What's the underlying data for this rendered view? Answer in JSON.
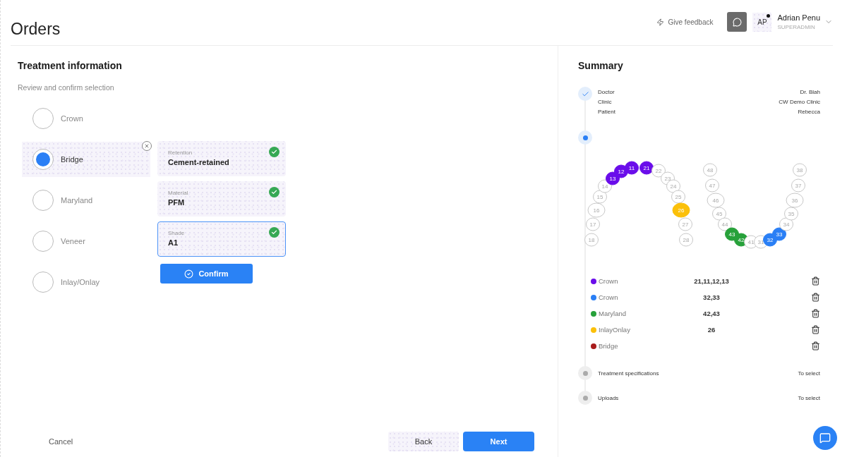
{
  "header": {
    "title": "Orders",
    "feedback": "Give feedback",
    "user": {
      "initials": "AP",
      "name": "Adrian Penu",
      "role": "SUPERADMIN",
      "online": true
    }
  },
  "treatment": {
    "title": "Treatment information",
    "subtitle": "Review and confirm selection",
    "options": [
      {
        "label": "Crown",
        "selected": false
      },
      {
        "label": "Bridge",
        "selected": true
      },
      {
        "label": "Maryland",
        "selected": false
      },
      {
        "label": "Veneer",
        "selected": false
      },
      {
        "label": "Inlay/Onlay",
        "selected": false
      }
    ],
    "fields": [
      {
        "label": "Retention",
        "value": "Cement-retained",
        "checked": true,
        "focused": false
      },
      {
        "label": "Material",
        "value": "PFM",
        "checked": true,
        "focused": false
      },
      {
        "label": "Shade",
        "value": "A1",
        "checked": true,
        "focused": true
      }
    ],
    "confirm": "Confirm"
  },
  "footer": {
    "cancel": "Cancel",
    "back": "Back",
    "next": "Next"
  },
  "summary": {
    "title": "Summary",
    "steps": [
      {
        "kind": "done",
        "details": [
          {
            "label": "Doctor",
            "value": "Dr. Blah"
          },
          {
            "label": "Clinic",
            "value": "CW Demo Clinic"
          },
          {
            "label": "Patient",
            "value": "Rebecca"
          }
        ]
      },
      {
        "kind": "current",
        "teeth": [
          {
            "number": "18"
          },
          {
            "number": "17"
          },
          {
            "number": "16"
          },
          {
            "number": "15"
          },
          {
            "number": "14"
          },
          {
            "number": "13",
            "color": "#6a0dea"
          },
          {
            "number": "12",
            "color": "#6a0dea"
          },
          {
            "number": "11",
            "color": "#6a0dea"
          },
          {
            "number": "21",
            "color": "#6a0dea"
          },
          {
            "number": "22"
          },
          {
            "number": "23"
          },
          {
            "number": "24"
          },
          {
            "number": "25"
          },
          {
            "number": "26",
            "color": "#fbc00a"
          },
          {
            "number": "27"
          },
          {
            "number": "28"
          },
          {
            "number": "48"
          },
          {
            "number": "47"
          },
          {
            "number": "46"
          },
          {
            "number": "45"
          },
          {
            "number": "44"
          },
          {
            "number": "43",
            "color": "#27a13a"
          },
          {
            "number": "42",
            "color": "#27a13a"
          },
          {
            "number": "41"
          },
          {
            "number": "31"
          },
          {
            "number": "32",
            "color": "#2a7ff5"
          },
          {
            "number": "33",
            "color": "#2a7ff5"
          },
          {
            "number": "34"
          },
          {
            "number": "35"
          },
          {
            "number": "36"
          },
          {
            "number": "37"
          },
          {
            "number": "38"
          }
        ],
        "legend": [
          {
            "label": "Crown",
            "teeth": "21,11,12,13",
            "color": "#6a0dea"
          },
          {
            "label": "Crown",
            "teeth": "32,33",
            "color": "#2a7ff5"
          },
          {
            "label": "Maryland",
            "teeth": "42,43",
            "color": "#27a13a"
          },
          {
            "label": "InlayOnlay",
            "teeth": "26",
            "color": "#fbc00a"
          },
          {
            "label": "Bridge",
            "color": "#a81c1c"
          }
        ]
      },
      {
        "kind": "pending",
        "label": "Treatment specifications",
        "value": "To select"
      },
      {
        "kind": "pending",
        "label": "Uploads",
        "value": "To select"
      }
    ]
  }
}
